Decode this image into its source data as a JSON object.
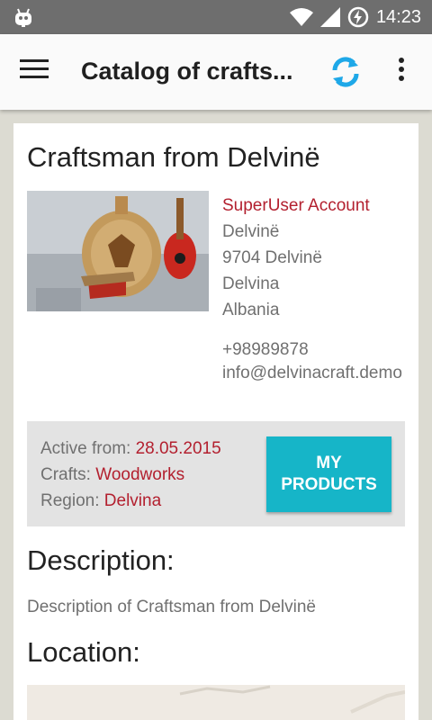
{
  "status_bar": {
    "time": "14:23"
  },
  "toolbar": {
    "title": "Catalog of crafts..."
  },
  "craftsman": {
    "title": "Craftsman from Delvinë",
    "account": "SuperUser Account",
    "address_line1": "Delvinë",
    "address_line2": "9704 Delvinë",
    "region": "Delvina",
    "country": "Albania",
    "phone": "+98989878",
    "email": "info@delvinacraft.demo"
  },
  "meta": {
    "active_label": "Active from: ",
    "active_value": "28.05.2015",
    "crafts_label": "Crafts: ",
    "crafts_value": "Woodworks",
    "region_label": "Region: ",
    "region_value": "Delvina",
    "button_line1": "MY",
    "button_line2": "PRODUCTS"
  },
  "description": {
    "heading": "Description:",
    "text": "Description of Craftsman from Delvinë"
  },
  "location": {
    "heading": "Location:"
  },
  "colors": {
    "accent": "#b3202f",
    "button": "#16b5c8",
    "refresh": "#1ea8e8"
  }
}
